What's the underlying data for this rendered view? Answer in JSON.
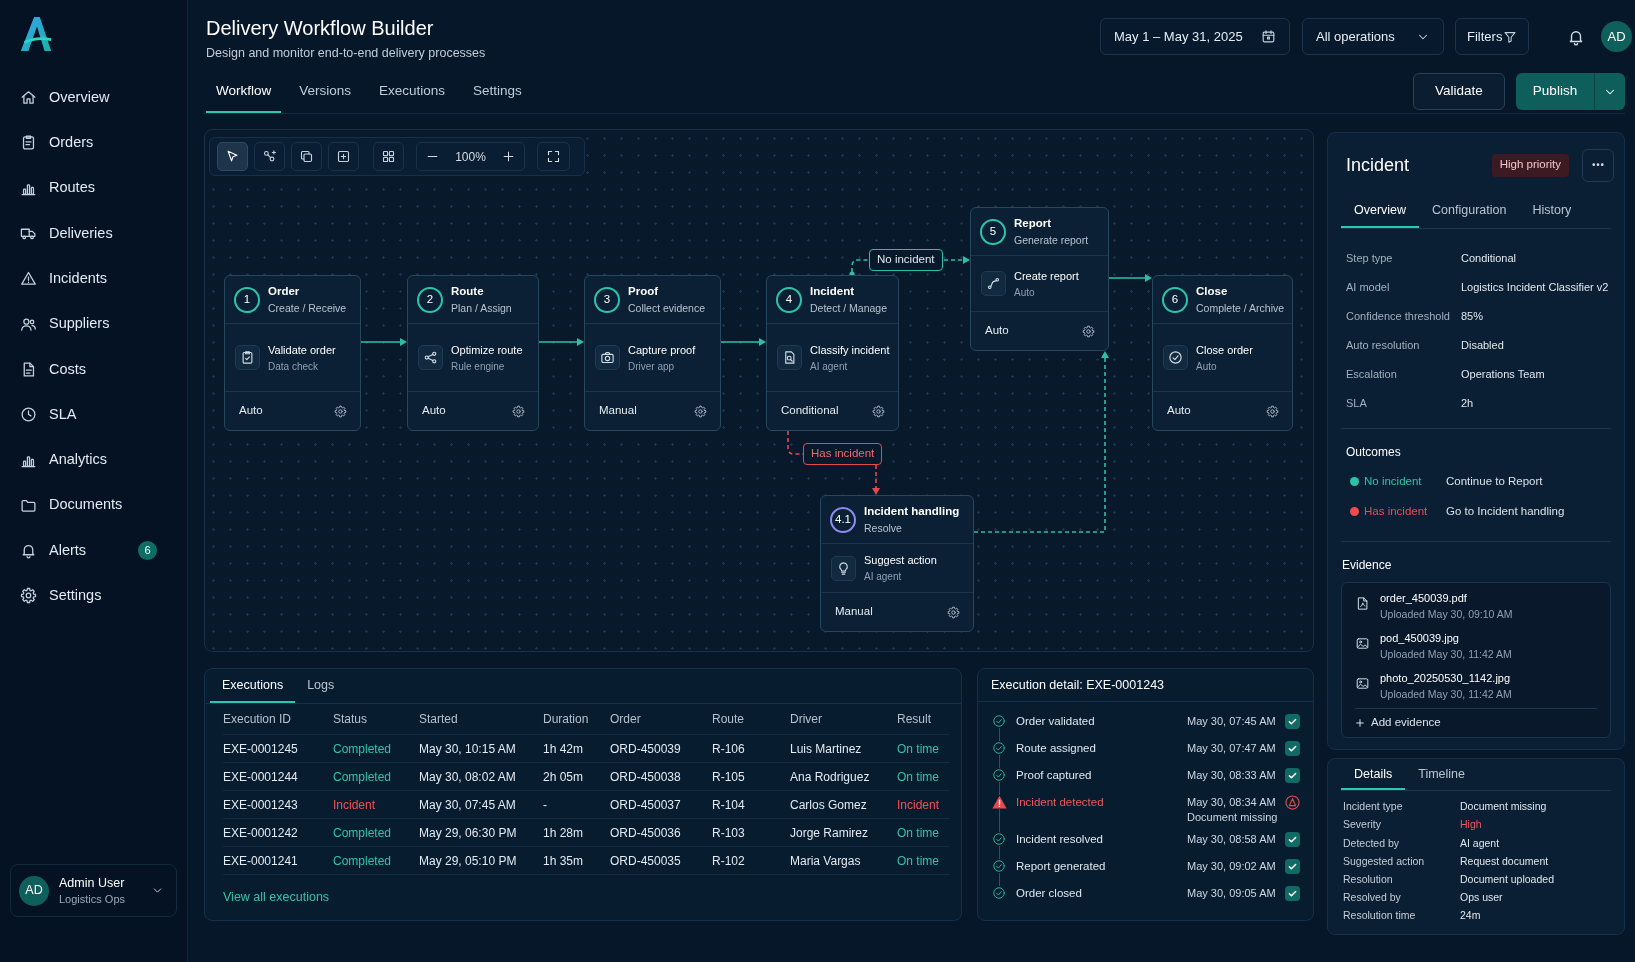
{
  "sidebar": {
    "items": [
      {
        "label": "Overview"
      },
      {
        "label": "Orders"
      },
      {
        "label": "Routes"
      },
      {
        "label": "Deliveries"
      },
      {
        "label": "Incidents"
      },
      {
        "label": "Suppliers"
      },
      {
        "label": "Costs"
      },
      {
        "label": "SLA"
      },
      {
        "label": "Analytics"
      },
      {
        "label": "Documents"
      },
      {
        "label": "Alerts",
        "badge": "6"
      },
      {
        "label": "Settings"
      }
    ],
    "user": {
      "initials": "AD",
      "name": "Admin User",
      "role": "Logistics Ops"
    }
  },
  "header": {
    "title": "Delivery Workflow Builder",
    "subtitle": "Design and monitor end-to-end delivery processes",
    "date_range": "May 1 – May 31, 2025",
    "operation_filter": "All operations",
    "filters": "Filters",
    "avatar": "AD"
  },
  "tabs": [
    {
      "label": "Workflow",
      "selected": true
    },
    {
      "label": "Versions",
      "selected": false
    },
    {
      "label": "Executions",
      "selected": false
    },
    {
      "label": "Settings",
      "selected": false
    }
  ],
  "actions": {
    "validate": "Validate",
    "publish": "Publish"
  },
  "canvas": {
    "tools": [
      {
        "selected": true
      },
      {
        "selected": false
      },
      {
        "selected": false
      },
      {
        "selected": false
      },
      {
        "selected": false
      }
    ],
    "zoom": "100%",
    "nodes": [
      {
        "number": "1",
        "title": "Order",
        "subtitle": "Create / Receive",
        "task": "Validate order",
        "task_detail": "Data check",
        "mode": "Auto",
        "color": "#2bc4ad"
      },
      {
        "number": "2",
        "title": "Route",
        "subtitle": "Plan / Assign",
        "task": "Optimize route",
        "task_detail": "Rule engine",
        "mode": "Auto",
        "color": "#2bc4ad"
      },
      {
        "number": "3",
        "title": "Proof",
        "subtitle": "Collect evidence",
        "task": "Capture proof",
        "task_detail": "Driver app",
        "mode": "Manual",
        "color": "#2bc4ad"
      },
      {
        "number": "4",
        "title": "Incident",
        "subtitle": "Detect / Manage",
        "task": "Classify incident",
        "task_detail": "AI agent",
        "mode": "Conditional",
        "color": "#2bc4ad"
      },
      {
        "number": "5",
        "title": "Report",
        "subtitle": "Generate report",
        "task": "Create report",
        "task_detail": "Auto",
        "mode": "Auto",
        "color": "#2bc4ad"
      },
      {
        "number": "6",
        "title": "Close",
        "subtitle": "Complete / Archive",
        "task": "Close order",
        "task_detail": "Auto",
        "mode": "Auto",
        "color": "#2bc4ad"
      },
      {
        "number": "4.1",
        "title": "Incident handling",
        "subtitle": "Resolve",
        "task": "Suggest action",
        "task_detail": "AI agent",
        "mode": "Manual",
        "color": "#8e8cf0"
      }
    ],
    "branches": [
      {
        "label": "No incident",
        "kind": "ok"
      },
      {
        "label": "Has incident",
        "kind": "alert"
      }
    ]
  },
  "executions": {
    "tabs": [
      {
        "label": "Executions",
        "selected": true
      },
      {
        "label": "Logs",
        "selected": false
      }
    ],
    "columns": [
      "Execution ID",
      "Status",
      "Started",
      "Duration",
      "Order",
      "Route",
      "Driver",
      "Result"
    ],
    "rows": [
      {
        "id": "EXE-0001245",
        "status": {
          "text": "Completed",
          "kind": "ok"
        },
        "started": "May 30, 10:15 AM",
        "duration": "1h 42m",
        "order": "ORD-450039",
        "route": "R-106",
        "driver": "Luis Martinez",
        "result": {
          "text": "On time",
          "kind": "ok"
        }
      },
      {
        "id": "EXE-0001244",
        "status": {
          "text": "Completed",
          "kind": "ok"
        },
        "started": "May 30, 08:02 AM",
        "duration": "2h 05m",
        "order": "ORD-450038",
        "route": "R-105",
        "driver": "Ana Rodriguez",
        "result": {
          "text": "On time",
          "kind": "ok"
        }
      },
      {
        "id": "EXE-0001243",
        "status": {
          "text": "Incident",
          "kind": "alert"
        },
        "started": "May 30, 07:45 AM",
        "duration": "-",
        "order": "ORD-450037",
        "route": "R-104",
        "driver": "Carlos Gomez",
        "result": {
          "text": "Incident",
          "kind": "alert"
        }
      },
      {
        "id": "EXE-0001242",
        "status": {
          "text": "Completed",
          "kind": "ok"
        },
        "started": "May 29, 06:30 PM",
        "duration": "1h 28m",
        "order": "ORD-450036",
        "route": "R-103",
        "driver": "Jorge Ramirez",
        "result": {
          "text": "On time",
          "kind": "ok"
        }
      },
      {
        "id": "EXE-0001241",
        "status": {
          "text": "Completed",
          "kind": "ok"
        },
        "started": "May 29, 05:10 PM",
        "duration": "1h 35m",
        "order": "ORD-450035",
        "route": "R-102",
        "driver": "Maria Vargas",
        "result": {
          "text": "On time",
          "kind": "ok"
        }
      }
    ],
    "view_all": "View all executions"
  },
  "execution_detail": {
    "title": "Execution detail: EXE-0001243",
    "steps": [
      {
        "label": "Order validated",
        "time": "May 30, 07:45 AM",
        "kind": "done"
      },
      {
        "label": "Route assigned",
        "time": "May 30, 07:47 AM",
        "kind": "done"
      },
      {
        "label": "Proof captured",
        "time": "May 30, 08:33 AM",
        "kind": "done"
      },
      {
        "label": "Incident detected",
        "time": "May 30, 08:34 AM",
        "note": "Document missing",
        "kind": "alert"
      },
      {
        "label": "Incident resolved",
        "time": "May 30, 08:58 AM",
        "kind": "done"
      },
      {
        "label": "Report generated",
        "time": "May 30, 09:02 AM",
        "kind": "done"
      },
      {
        "label": "Order closed",
        "time": "May 30, 09:05 AM",
        "kind": "done"
      }
    ]
  },
  "inspector": {
    "title": "Incident",
    "priority": "High priority",
    "tabs": [
      {
        "label": "Overview",
        "selected": true
      },
      {
        "label": "Configuration",
        "selected": false
      },
      {
        "label": "History",
        "selected": false
      }
    ],
    "properties": [
      {
        "label": "Step type",
        "value": "Conditional"
      },
      {
        "label": "AI model",
        "value": "Logistics Incident Classifier v2"
      },
      {
        "label": "Confidence threshold",
        "value": "85%"
      },
      {
        "label": "Auto resolution",
        "value": "Disabled"
      },
      {
        "label": "Escalation",
        "value": "Operations Team"
      },
      {
        "label": "SLA",
        "value": "2h"
      }
    ],
    "outcomes_title": "Outcomes",
    "outcomes": [
      {
        "label": "No incident",
        "action": "Continue to Report",
        "color": "#2cc4a8"
      },
      {
        "label": "Has incident",
        "action": "Go to Incident handling",
        "color": "#ef4a4f"
      }
    ],
    "evidence_title": "Evidence",
    "evidence": [
      {
        "name": "order_450039.pdf",
        "uploaded": "Uploaded May 30, 09:10 AM",
        "kind": "pdf"
      },
      {
        "name": "pod_450039.jpg",
        "uploaded": "Uploaded May 30, 11:42 AM",
        "kind": "image"
      },
      {
        "name": "photo_20250530_1142.jpg",
        "uploaded": "Uploaded May 30, 11:42 AM",
        "kind": "image"
      }
    ],
    "add_evidence": "Add evidence"
  },
  "details": {
    "tabs": [
      {
        "label": "Details",
        "selected": true
      },
      {
        "label": "Timeline",
        "selected": false
      }
    ],
    "rows": [
      {
        "label": "Incident type",
        "value": "Document missing",
        "kind": "plain"
      },
      {
        "label": "Severity",
        "value": "High",
        "kind": "alert"
      },
      {
        "label": "Detected by",
        "value": "AI agent",
        "kind": "plain"
      },
      {
        "label": "Suggested action",
        "value": "Request document",
        "kind": "plain"
      },
      {
        "label": "Resolution",
        "value": "Document uploaded",
        "kind": "plain"
      },
      {
        "label": "Resolved by",
        "value": "Ops user",
        "kind": "plain"
      },
      {
        "label": "Resolution time",
        "value": "24m",
        "kind": "plain"
      }
    ]
  }
}
